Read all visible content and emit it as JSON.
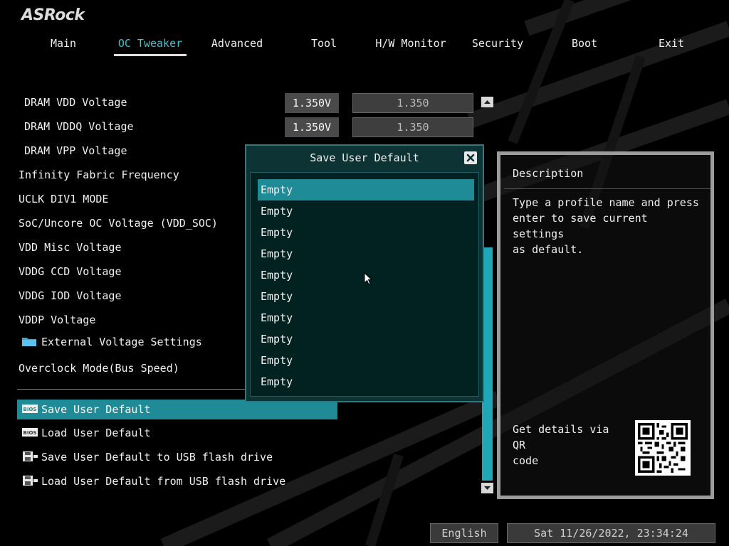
{
  "brand": {
    "logo": "ASRock"
  },
  "tabs": [
    {
      "label": "Main"
    },
    {
      "label": "OC Tweaker",
      "active": true
    },
    {
      "label": "Advanced"
    },
    {
      "label": "Tool"
    },
    {
      "label": "H/W Monitor"
    },
    {
      "label": "Security"
    },
    {
      "label": "Boot"
    },
    {
      "label": "Exit"
    }
  ],
  "settings": {
    "dram_vdd": {
      "label": "DRAM VDD Voltage",
      "value": "1.350V",
      "input": "1.350"
    },
    "dram_vddq": {
      "label": "DRAM VDDQ Voltage",
      "value": "1.350V",
      "input": "1.350"
    },
    "dram_vpp": {
      "label": "DRAM VPP Voltage"
    },
    "infinity_fabric": {
      "label": "Infinity Fabric Frequency"
    },
    "uclk": {
      "label": "UCLK DIV1 MODE"
    },
    "soc_voltage": {
      "label": "SoC/Uncore OC Voltage (VDD_SOC)"
    },
    "vdd_misc": {
      "label": "VDD Misc Voltage"
    },
    "vddg_ccd": {
      "label": "VDDG CCD Voltage"
    },
    "vddg_iod": {
      "label": "VDDG IOD Voltage"
    },
    "vddp": {
      "label": "VDDP Voltage"
    },
    "external_voltage": {
      "label": "External Voltage Settings",
      "icon": "folder-icon"
    },
    "overclock_mode": {
      "label": "Overclock Mode(Bus Speed)"
    }
  },
  "profile_actions": [
    {
      "label": "Save User Default",
      "icon": "bios-chip-icon",
      "selected": true
    },
    {
      "label": "Load User Default",
      "icon": "bios-chip-icon"
    },
    {
      "label": "Save User Default to USB flash drive",
      "icon": "floppy-disk-icon"
    },
    {
      "label": "Load User Default from USB flash drive",
      "icon": "floppy-disk-icon"
    }
  ],
  "dialog": {
    "title": "Save User Default",
    "close_icon": "close-icon",
    "items": [
      "Empty",
      "Empty",
      "Empty",
      "Empty",
      "Empty",
      "Empty",
      "Empty",
      "Empty",
      "Empty",
      "Empty"
    ],
    "selected_index": 0
  },
  "description": {
    "title": "Description",
    "lines": [
      "Type a profile name and press",
      "enter to save current settings",
      "as default."
    ],
    "qr_lines": [
      "Get details via QR",
      "code"
    ]
  },
  "footer": {
    "language": "English",
    "datetime": "Sat 11/26/2022, 23:34:24"
  },
  "colors": {
    "accent": "#1e8b97",
    "active_tab": "#39c5d3",
    "dialog_bg": "#0d3334",
    "scroll_thumb": "#1fa7b7"
  }
}
